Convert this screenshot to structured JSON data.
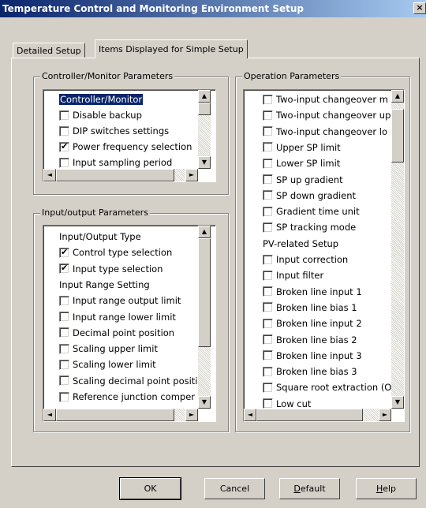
{
  "window": {
    "title": "Temperature Control and Monitoring Environment Setup",
    "close_glyph": "×"
  },
  "tabs": [
    {
      "label": "Detailed Setup",
      "active": false
    },
    {
      "label": "Items Displayed for Simple Setup",
      "active": true
    }
  ],
  "controller_group": {
    "title": "Controller/Monitor Parameters",
    "items": [
      {
        "type": "header",
        "label": "Controller/Monitor",
        "selected": true
      },
      {
        "type": "check",
        "label": "Disable backup",
        "checked": false
      },
      {
        "type": "check",
        "label": "DIP switches settings",
        "checked": false
      },
      {
        "type": "check",
        "label": "Power frequency selection",
        "checked": true
      },
      {
        "type": "check",
        "label": "Input sampling period",
        "checked": false
      }
    ]
  },
  "io_group": {
    "title": "Input/output Parameters",
    "items": [
      {
        "type": "header",
        "label": "Input/Output Type"
      },
      {
        "type": "check",
        "label": "Control type selection",
        "checked": true
      },
      {
        "type": "check",
        "label": "Input type selection",
        "checked": true
      },
      {
        "type": "header",
        "label": "Input Range Setting"
      },
      {
        "type": "check",
        "label": "Input range output limit",
        "checked": false
      },
      {
        "type": "check",
        "label": "Input range lower limit",
        "checked": false
      },
      {
        "type": "check",
        "label": "Decimal point position",
        "checked": false
      },
      {
        "type": "check",
        "label": "Scaling upper limit",
        "checked": false
      },
      {
        "type": "check",
        "label": "Scaling lower limit",
        "checked": false
      },
      {
        "type": "check",
        "label": "Scaling decimal point positi",
        "checked": false
      },
      {
        "type": "check",
        "label": "Reference junction comper",
        "checked": false
      }
    ]
  },
  "operation_group": {
    "title": "Operation Parameters",
    "items": [
      {
        "type": "check",
        "label": "Two-input changeover m",
        "checked": false
      },
      {
        "type": "check",
        "label": "Two-input changeover up",
        "checked": false
      },
      {
        "type": "check",
        "label": "Two-input changeover lo",
        "checked": false
      },
      {
        "type": "check",
        "label": "Upper SP limit",
        "checked": false
      },
      {
        "type": "check",
        "label": "Lower SP limit",
        "checked": false
      },
      {
        "type": "check",
        "label": "SP up gradient",
        "checked": false
      },
      {
        "type": "check",
        "label": "SP down gradient",
        "checked": false
      },
      {
        "type": "check",
        "label": "Gradient time unit",
        "checked": false
      },
      {
        "type": "check",
        "label": "SP tracking mode",
        "checked": false
      },
      {
        "type": "header",
        "label": "PV-related Setup"
      },
      {
        "type": "check",
        "label": "Input correction",
        "checked": false
      },
      {
        "type": "check",
        "label": "Input filter",
        "checked": false
      },
      {
        "type": "check",
        "label": "Broken line input 1",
        "checked": false
      },
      {
        "type": "check",
        "label": "Broken line bias 1",
        "checked": false
      },
      {
        "type": "check",
        "label": "Broken line input 2",
        "checked": false
      },
      {
        "type": "check",
        "label": "Broken line bias 2",
        "checked": false
      },
      {
        "type": "check",
        "label": "Broken line input 3",
        "checked": false
      },
      {
        "type": "check",
        "label": "Broken line bias 3",
        "checked": false
      },
      {
        "type": "check",
        "label": "Square root extraction (Oi",
        "checked": false
      },
      {
        "type": "check",
        "label": "Low cut",
        "checked": false
      }
    ]
  },
  "buttons": {
    "ok": "OK",
    "cancel": "Cancel",
    "default_first": "D",
    "default_rest": "efault",
    "help_first": "H",
    "help_rest": "elp"
  },
  "glyphs": {
    "up": "▲",
    "down": "▼",
    "left": "◄",
    "right": "►"
  }
}
